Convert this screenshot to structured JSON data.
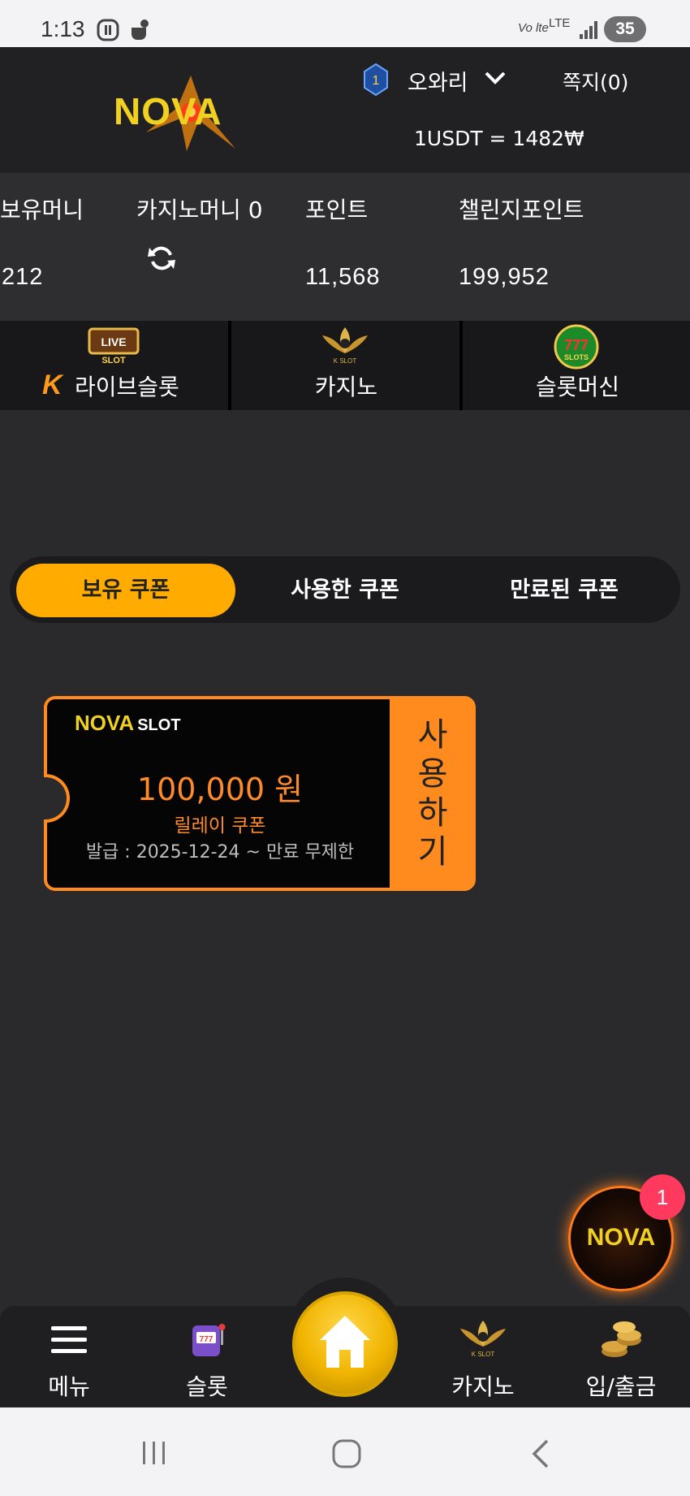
{
  "status_bar": {
    "time": "1:13",
    "network": "Vo lte",
    "signal_type": "LTE",
    "battery": "35"
  },
  "header": {
    "logo_text": "NOVA",
    "level": "1",
    "username": "오와리",
    "messages": "쪽지(0)",
    "exchange_rate": "1USDT = 1482₩"
  },
  "balances": [
    {
      "label": "보유머니",
      "value": "212"
    },
    {
      "label": "카지노머니 0",
      "value": ""
    },
    {
      "label": "포인트",
      "value": "11,568"
    },
    {
      "label": "챌린지포인트",
      "value": "199,952"
    }
  ],
  "categories": [
    {
      "label": "라이브슬롯",
      "badge": "K",
      "icon": "live-slot-icon",
      "icon_text": "LIVE SLOT"
    },
    {
      "label": "카지노",
      "icon": "k-slot-lotus-icon",
      "icon_text": "K SLOT"
    },
    {
      "label": "슬롯머신",
      "icon": "777-slots-icon",
      "icon_text": "777 SLOTS"
    }
  ],
  "coupon_tabs": [
    {
      "label": "보유 쿠폰",
      "active": true
    },
    {
      "label": "사용한 쿠폰",
      "active": false
    },
    {
      "label": "만료된 쿠폰",
      "active": false
    }
  ],
  "coupon": {
    "brand": "NOVA",
    "brand_suffix": "SLOT",
    "amount": "100,000 원",
    "name": "릴레이 쿠폰",
    "issued": "발급 : 2025-12-24 ~ 만료 무제한",
    "action": "사용하기"
  },
  "floating_badge": {
    "logo_text": "NOVA",
    "count": "1"
  },
  "bottom_nav": [
    {
      "label": "메뉴",
      "icon": "hamburger-menu-icon"
    },
    {
      "label": "슬롯",
      "icon": "slot-machine-icon"
    },
    {
      "label": "",
      "icon": "home-icon"
    },
    {
      "label": "카지노",
      "icon": "k-slot-lotus-icon"
    },
    {
      "label": "입/출금",
      "icon": "gold-coins-icon"
    }
  ],
  "colors": {
    "accent": "#ffab00",
    "coupon_orange": "#ff8a1d",
    "background": "#2a2a2d",
    "header": "#212123",
    "badge_pink": "#ff3a5e"
  }
}
